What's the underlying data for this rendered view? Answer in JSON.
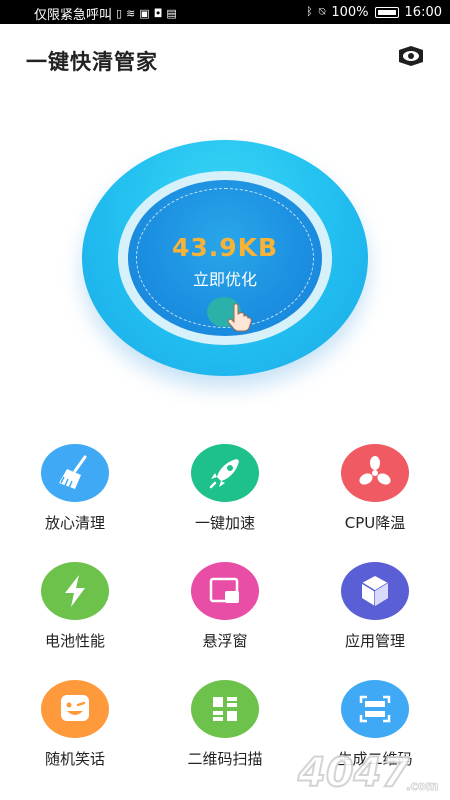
{
  "status_bar": {
    "carrier": "仅限紧急呼叫",
    "battery": "100%",
    "time": "16:00"
  },
  "header": {
    "title": "一键快清管家"
  },
  "hero": {
    "size": "43.9KB",
    "action": "立即优化"
  },
  "features": [
    {
      "label": "放心清理",
      "icon": "broom-icon",
      "color": "#3fa9f5"
    },
    {
      "label": "一键加速",
      "icon": "rocket-icon",
      "color": "#1ec08c"
    },
    {
      "label": "CPU降温",
      "icon": "fan-icon",
      "color": "#ef5a63"
    },
    {
      "label": "电池性能",
      "icon": "lightning-icon",
      "color": "#6cc24a"
    },
    {
      "label": "悬浮窗",
      "icon": "floating-window-icon",
      "color": "#e94ea6"
    },
    {
      "label": "应用管理",
      "icon": "cube-icon",
      "color": "#5b5fd6"
    },
    {
      "label": "随机笑话",
      "icon": "wink-face-icon",
      "color": "#ff9a3c"
    },
    {
      "label": "二维码扫描",
      "icon": "qr-scan-icon",
      "color": "#6cc24a"
    },
    {
      "label": "生成二维码",
      "icon": "scan-frame-icon",
      "color": "#3fa9f5"
    }
  ],
  "watermark": {
    "text": "4047",
    "suffix": ".com"
  }
}
